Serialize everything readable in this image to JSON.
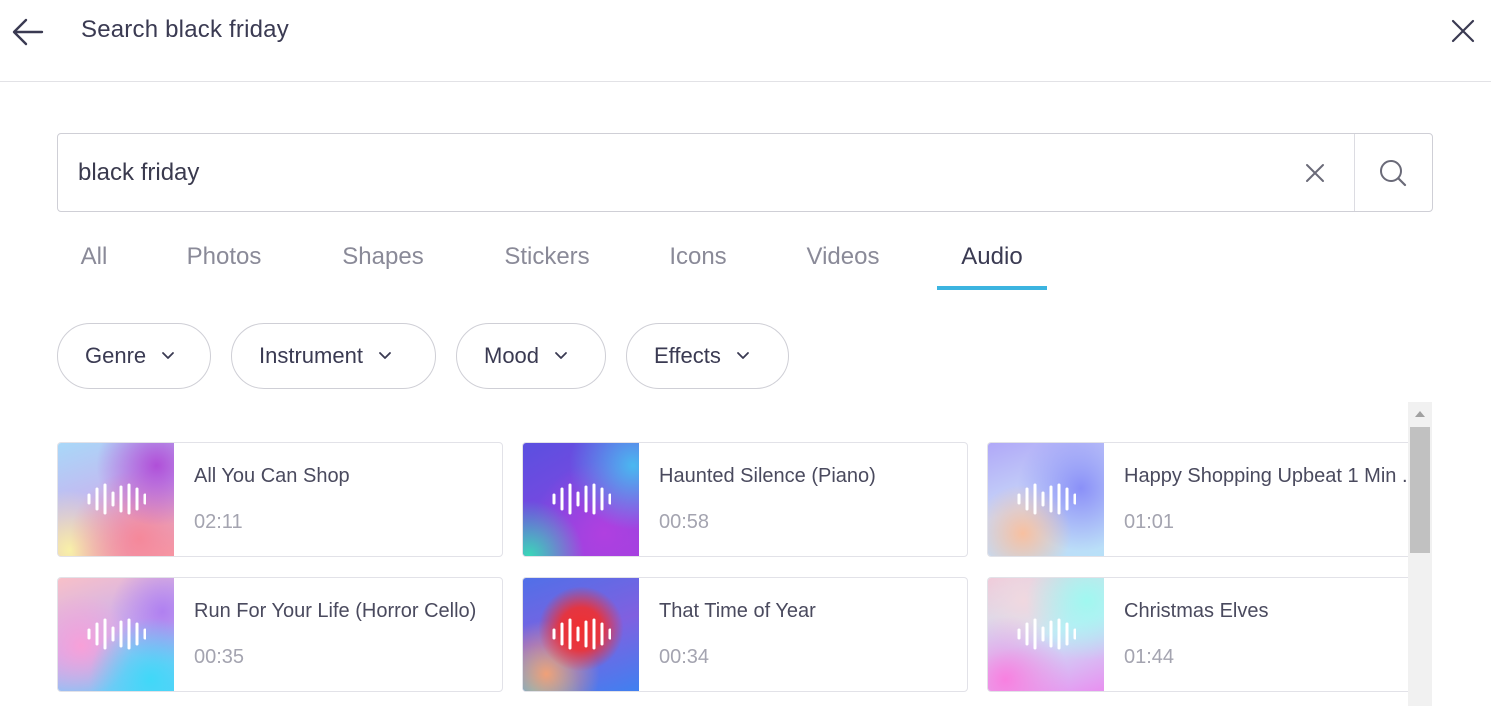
{
  "header": {
    "title": "Search black friday",
    "back_icon": "arrow-left-icon",
    "close_icon": "close-icon"
  },
  "search": {
    "value": "black friday",
    "clear_icon": "clear-icon",
    "search_icon": "search-icon"
  },
  "tabs": [
    {
      "label": "All",
      "active": false
    },
    {
      "label": "Photos",
      "active": false
    },
    {
      "label": "Shapes",
      "active": false
    },
    {
      "label": "Stickers",
      "active": false
    },
    {
      "label": "Icons",
      "active": false
    },
    {
      "label": "Videos",
      "active": false
    },
    {
      "label": "Audio",
      "active": true
    }
  ],
  "filters": [
    {
      "label": "Genre"
    },
    {
      "label": "Instrument"
    },
    {
      "label": "Mood"
    },
    {
      "label": "Effects"
    }
  ],
  "results": [
    {
      "title": "All You Can Shop",
      "duration": "02:11"
    },
    {
      "title": "Haunted Silence (Piano)",
      "duration": "00:58"
    },
    {
      "title": "Happy Shopping Upbeat 1 Min ..",
      "duration": "01:01"
    },
    {
      "title": "Run For Your Life (Horror Cello)",
      "duration": "00:35"
    },
    {
      "title": "That Time of Year",
      "duration": "00:34"
    },
    {
      "title": "Christmas Elves",
      "duration": "01:44"
    }
  ],
  "colors": {
    "accent": "#3cb4e0",
    "text": "#3a3a52",
    "muted": "#8a8a98"
  }
}
